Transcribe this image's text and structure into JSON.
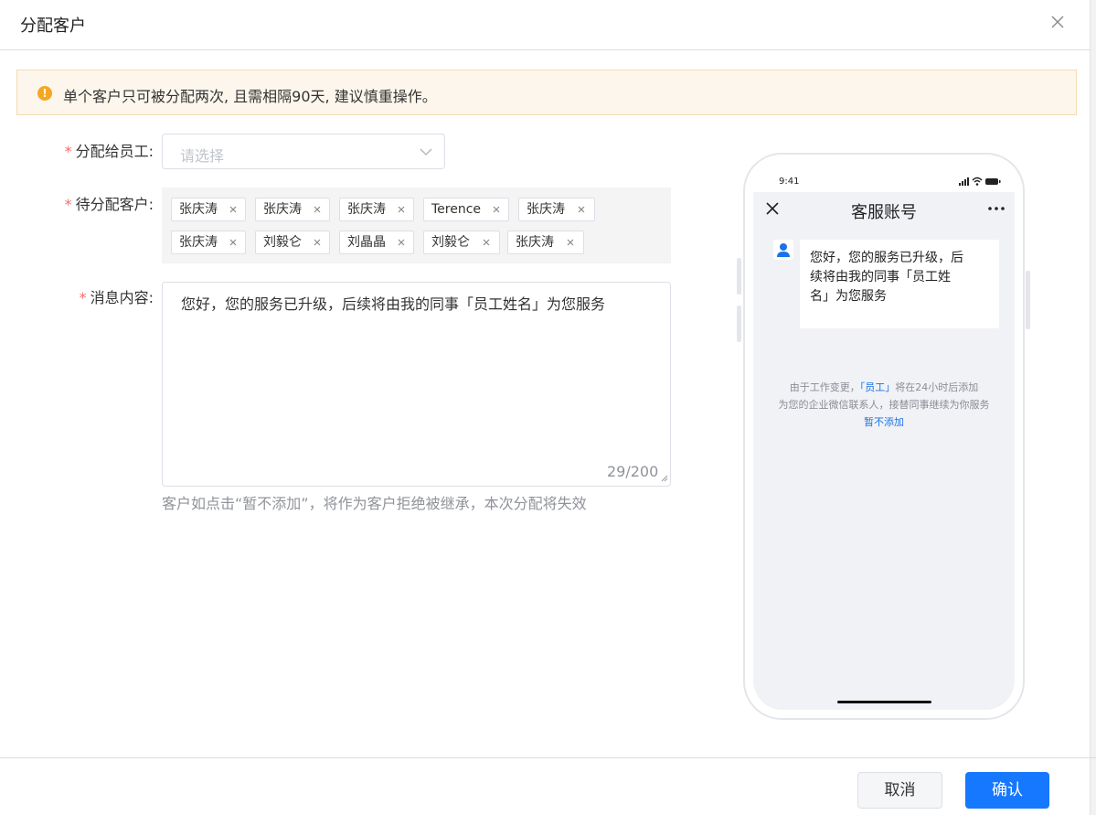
{
  "dialog": {
    "title": "分配客户"
  },
  "alert": {
    "icon": "warning-icon",
    "text": "单个客户只可被分配两次, 且需相隔90天, 建议慎重操作。",
    "color": "#f5a623"
  },
  "form": {
    "required_mark": "*",
    "employee": {
      "label": "分配给员工:",
      "placeholder": "请选择"
    },
    "customers": {
      "label": "待分配客户:",
      "tags": [
        "张庆涛",
        "张庆涛",
        "张庆涛",
        "Terence",
        "张庆涛",
        "张庆涛",
        "刘毅仑",
        "刘晶晶",
        "刘毅仑",
        "张庆涛"
      ]
    },
    "message": {
      "label": "消息内容:",
      "value": "您好，您的服务已升级，后续将由我的同事「员工姓名」为您服务",
      "counter": "29/200"
    },
    "hint": "客户如点击“暂不添加”，将作为客户拒绝被继承，本次分配将失效"
  },
  "phone": {
    "time": "9:41",
    "nav_title": "客服账号",
    "bubble_lines": [
      "您好，您的服务已升级，后",
      "续将由我的同事「员工姓",
      "名」为您服务"
    ],
    "sys_line1_a": "由于工作变更，",
    "sys_line1_link": "「员工」",
    "sys_line1_b": "将在24小时后添加",
    "sys_line2": "为您的企业微信联系人，接替同事继续为你服务",
    "sys_link2": "暂不添加",
    "link_color": "#1a73e8"
  },
  "footer": {
    "cancel_label": "取消",
    "ok_label": "确认",
    "accent": "#1677ff"
  }
}
